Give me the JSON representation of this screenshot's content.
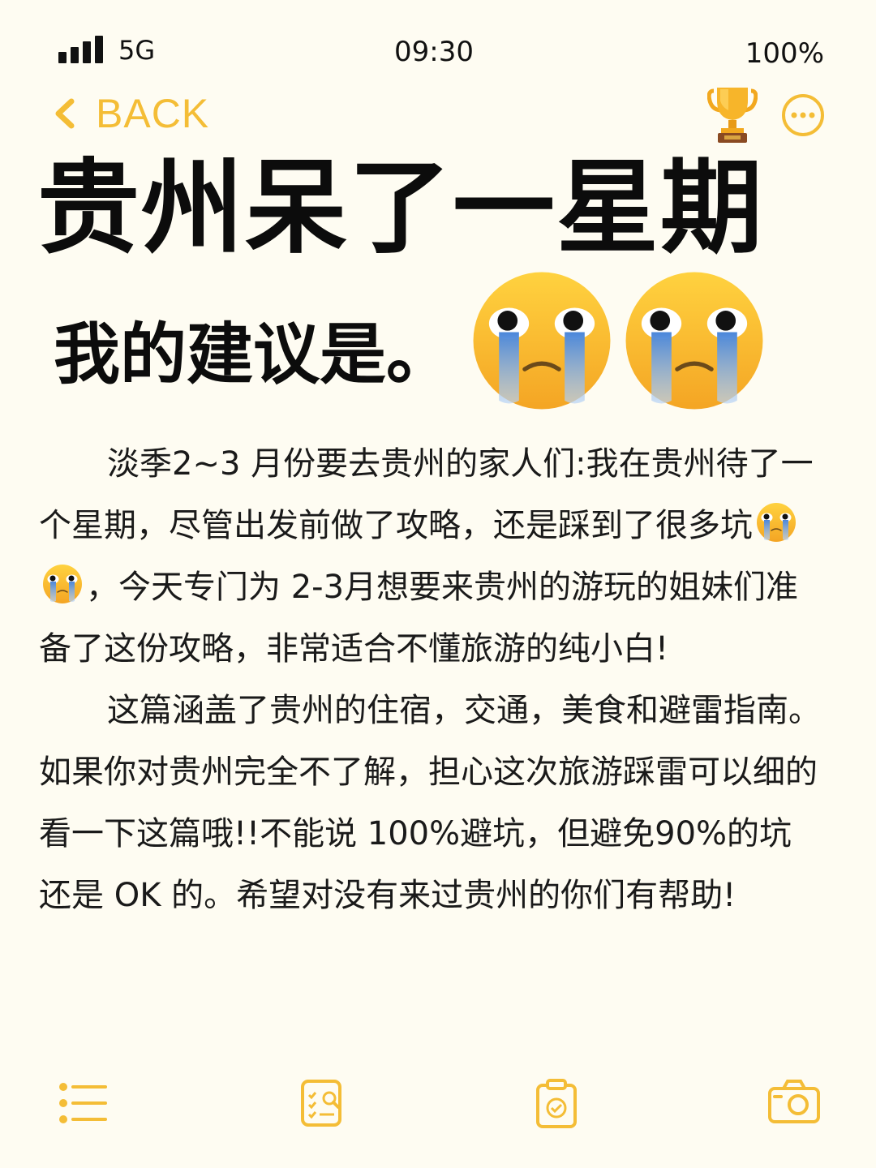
{
  "status_bar": {
    "network": "5G",
    "time": "09:30",
    "battery": "100%"
  },
  "nav": {
    "back_label": "BACK",
    "icons": [
      "chevron-left-icon",
      "trophy-icon",
      "more-icon"
    ]
  },
  "title": "贵州呆了一星期",
  "subtitle": "我的建议是。",
  "body": {
    "p1_a": "淡季2~3 月份要去贵州的家人们:我在贵州待了一个星期，尽管出发前做了攻略，还是踩到了很多坑",
    "p1_b": "，今天专门为 2-3月想要来贵州的游玩的姐妹们准备了这份攻略，非常适合不懂旅游的纯小白!",
    "p2": "这篇涵盖了贵州的住宿，交通，美食和避雷指南。如果你对贵州完全不了解，担心这次旅游踩雷可以细的看一下这篇哦!!不能说 100%避坑，但避免90%的坑还是 OK 的。希望对没有来过贵州的你们有帮助!"
  },
  "emojis": [
    "crying-face-icon",
    "crying-face-icon"
  ],
  "tab_bar": {
    "icons": [
      "list-icon",
      "search-notes-icon",
      "clipboard-check-icon",
      "camera-icon"
    ]
  },
  "colors": {
    "accent": "#f4bd36",
    "background": "#fefcf2",
    "text": "#111111"
  }
}
